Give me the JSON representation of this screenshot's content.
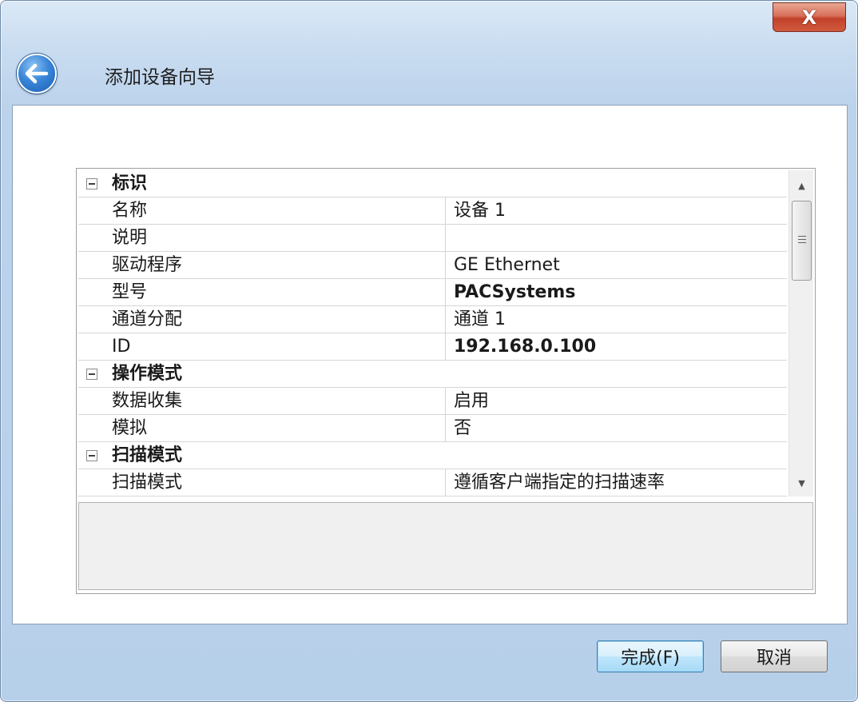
{
  "window": {
    "title": "添加设备向导",
    "close_label": "X"
  },
  "property_grid": {
    "rows": [
      {
        "kind": "category",
        "name": "标识",
        "value": ""
      },
      {
        "kind": "property",
        "name": "名称",
        "value": "设备 1",
        "bold": false
      },
      {
        "kind": "property",
        "name": "说明",
        "value": "",
        "bold": false
      },
      {
        "kind": "property",
        "name": "驱动程序",
        "value": "GE Ethernet",
        "bold": false
      },
      {
        "kind": "property",
        "name": "型号",
        "value": "PACSystems",
        "bold": true
      },
      {
        "kind": "property",
        "name": "通道分配",
        "value": "通道 1",
        "bold": false
      },
      {
        "kind": "property",
        "name": "ID",
        "value": "192.168.0.100",
        "bold": true
      },
      {
        "kind": "category",
        "name": "操作模式",
        "value": ""
      },
      {
        "kind": "property",
        "name": "数据收集",
        "value": "启用",
        "bold": false
      },
      {
        "kind": "property",
        "name": "模拟",
        "value": "否",
        "bold": false
      },
      {
        "kind": "category",
        "name": "扫描模式",
        "value": ""
      },
      {
        "kind": "property",
        "name": "扫描模式",
        "value": "遵循客户端指定的扫描速率",
        "bold": false
      }
    ]
  },
  "buttons": {
    "finish_label": "完成(F)",
    "cancel_label": "取消"
  },
  "icons": {
    "back": "back-arrow-icon",
    "close": "close-icon",
    "collapse": "collapse-minus-icon",
    "scroll_up": "triangle-up-icon",
    "scroll_down": "triangle-down-icon"
  },
  "colors": {
    "title_bar": "#c9dcf0",
    "close_button": "#c2412a",
    "default_button": "#bee6fd",
    "back_button": "#3a86d8"
  }
}
